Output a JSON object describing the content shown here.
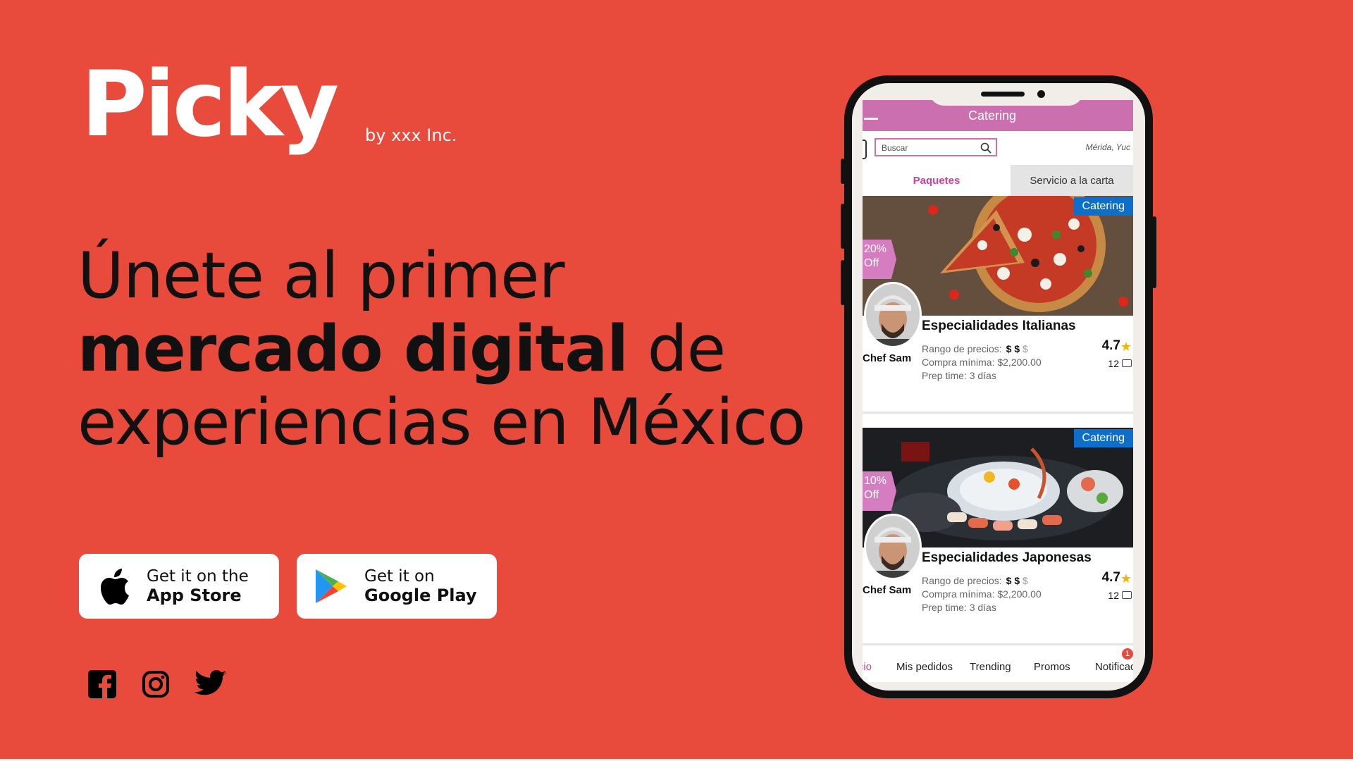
{
  "brand": {
    "name": "Picky",
    "byline": "by xxx Inc."
  },
  "headline": {
    "line1": "Únete al primer",
    "line2_bold": "mercado digital",
    "line2_rest": " de",
    "line3": "experiencias en México"
  },
  "stores": {
    "apple": {
      "small": "Get it on the",
      "big": "App Store"
    },
    "google": {
      "small": "Get it on",
      "big": "Google Play"
    }
  },
  "social": [
    "facebook-icon",
    "instagram-icon",
    "twitter-icon"
  ],
  "colors": {
    "background": "#E84A3C",
    "app_header": "#CC6FAF",
    "tag": "#0D6FC9"
  },
  "app": {
    "header_title": "Catering",
    "search_placeholder": "Buscar",
    "location": "Mérida, Yuc",
    "tabs": [
      "Paquetes",
      "Servicio a la carta"
    ],
    "cards": [
      {
        "tag": "Catering",
        "discount_pct": "20%",
        "discount_off": "Off",
        "chef": "Chef Sam",
        "title": "Especialidades Italianas",
        "price_label": "Rango de precios:",
        "price_dark": "$ $",
        "price_light": "$",
        "min": "Compra mínima: $2,200.00",
        "prep": "Prep time: 3 días",
        "rating": "4.7",
        "reviews": "12"
      },
      {
        "tag": "Catering",
        "discount_pct": "10%",
        "discount_off": "Off",
        "chef": "Chef Sam",
        "title": "Especialidades Japonesas",
        "price_label": "Rango de precios:",
        "price_dark": "$ $",
        "price_light": "$",
        "min": "Compra mínima: $2,200.00",
        "prep": "Prep time: 3 días",
        "rating": "4.7",
        "reviews": "12"
      }
    ],
    "nav": {
      "inicio": "Inicio",
      "pedidos": "Mis pedidos",
      "trending": "Trending",
      "promos": "Promos",
      "notif": "Notificaciones",
      "badge": "1"
    }
  }
}
